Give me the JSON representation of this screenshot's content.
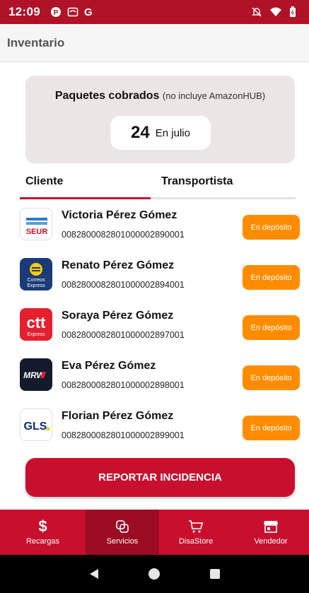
{
  "status_bar": {
    "time": "12:09",
    "icons_left": [
      "p-circle-icon",
      "cast-icon",
      "google-icon"
    ],
    "google_letter": "G",
    "icons_right": [
      "bell-off-icon",
      "wifi-icon",
      "battery-icon"
    ]
  },
  "app_bar": {
    "title": "Inventario"
  },
  "summary": {
    "title": "Paquetes cobrados",
    "note": "(no incluye AmazonHUB)",
    "count": "24",
    "month_label": "En julio"
  },
  "tabs": [
    {
      "label": "Cliente",
      "active": true
    },
    {
      "label": "Transportista",
      "active": false
    }
  ],
  "packages": [
    {
      "carrier": "SEUR",
      "name": "Victoria Pérez Gómez",
      "code": "008280008280100000289000​1",
      "status": "En depósito"
    },
    {
      "carrier": "Correos Express",
      "name": "Renato Pérez Gómez",
      "code": "0082800082801000002894001",
      "status": "En depósito"
    },
    {
      "carrier": "ctt Express",
      "name": "Soraya Pérez Gómez",
      "code": "0082800082801000002897001",
      "status": "En depósito"
    },
    {
      "carrier": "MRW",
      "name": "Eva Pérez Gómez",
      "code": "0082800082801000002898001",
      "status": "En depósito"
    },
    {
      "carrier": "GLS",
      "name": "Florian Pérez Gómez",
      "code": "0082800082801000002899001",
      "status": "En depósito"
    }
  ],
  "logos": {
    "seur_text": "SEUR",
    "correos_line1": "Correos",
    "correos_line2": "Express",
    "ctt_text": "ctt",
    "ctt_sub": "Express",
    "mrw_text": "MRW",
    "gls_text": "GLS"
  },
  "report_button": {
    "label": "REPORTAR INCIDENCIA"
  },
  "bottom_nav": [
    {
      "label": "Recargas",
      "icon": "dollar-icon",
      "active": false
    },
    {
      "label": "Servicios",
      "icon": "copy-icon",
      "active": true
    },
    {
      "label": "DisaStore",
      "icon": "cart-icon",
      "active": false
    },
    {
      "label": "Vendedor",
      "icon": "store-icon",
      "active": false
    }
  ],
  "colors": {
    "brand_red": "#c8102e",
    "status_bar": "#b01227",
    "active_nav": "#9c0c22",
    "badge_orange": "#ff8c00",
    "summary_bg": "#e9e6e5"
  }
}
